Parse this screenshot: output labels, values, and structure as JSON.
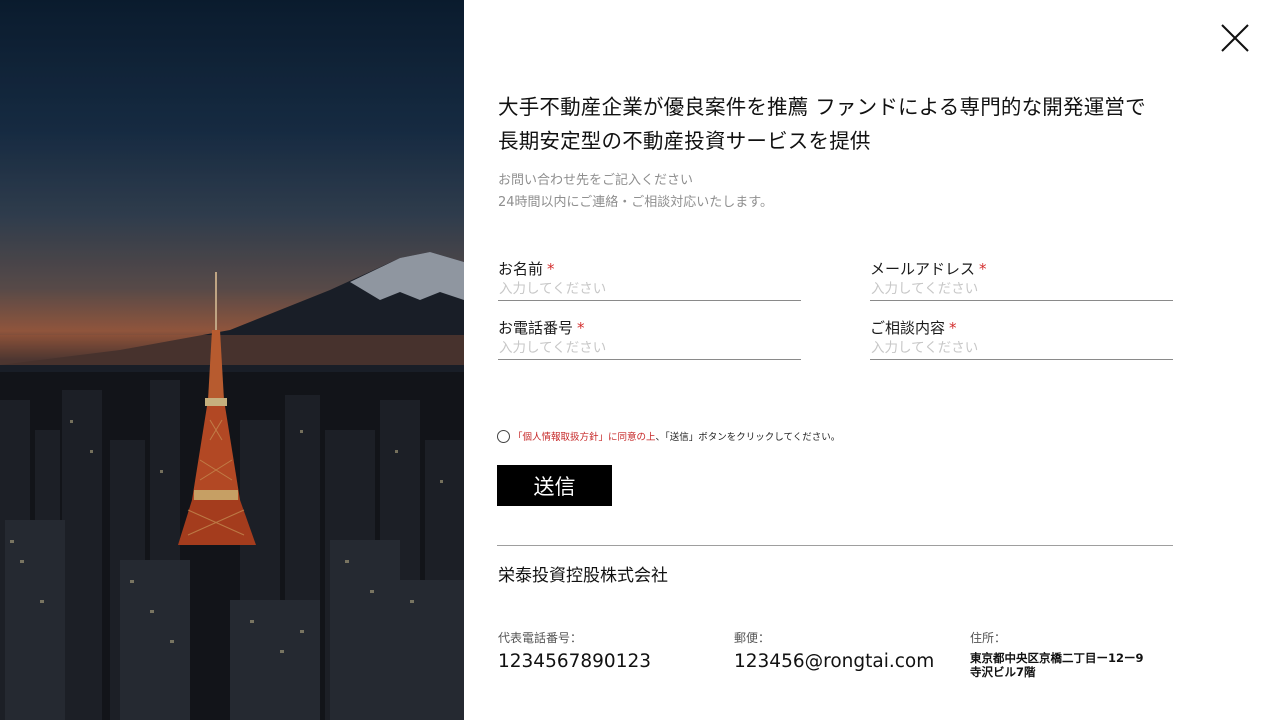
{
  "close": {
    "icon": "close-icon"
  },
  "headline": {
    "line1": "大手不動産企業が優良案件を推薦 ファンドによる専門的な開発運営で",
    "line2": "長期安定型の不動産投資サービスを提供"
  },
  "intro": {
    "line1": "お問い合わせ先をご記入ください",
    "line2": "24時間以内にご連絡・ご相談対応いたします。"
  },
  "form": {
    "required_mark": "*",
    "name": {
      "label": "お名前",
      "placeholder": "入力してください",
      "value": ""
    },
    "email": {
      "label": "メールアドレス",
      "placeholder": "入力してください",
      "value": ""
    },
    "phone": {
      "label": "お電話番号",
      "placeholder": "入力してください",
      "value": ""
    },
    "inquiry": {
      "label": "ご相談内容",
      "placeholder": "入力してください",
      "value": ""
    }
  },
  "consent": {
    "checked": false,
    "link_text": "「個人情報取扱方針」に同意の上",
    "rest_text": "、「送信」ボタンをクリックしてください。"
  },
  "submit": {
    "label": "送信"
  },
  "company": {
    "name": "栄泰投資控股株式会社"
  },
  "contact": {
    "phone_label": "代表電話番号：",
    "phone_value": "1234567890123",
    "mail_label": "郵便：",
    "mail_value": "123456@rongtai.com",
    "address_label": "住所：",
    "address_line1": "東京都中央区京橋二丁目ー12ー9",
    "address_line2": "寺沢ビル7階"
  },
  "colors": {
    "required": "#d32f2f",
    "button_bg": "#000000",
    "link": "#c62828"
  }
}
